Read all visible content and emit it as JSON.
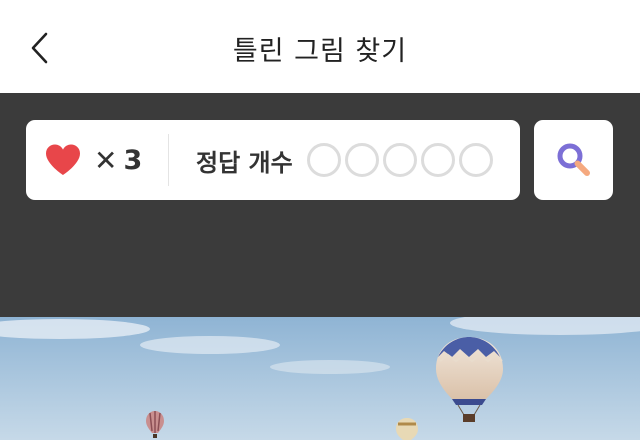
{
  "header": {
    "title": "틀린 그림 찾기",
    "back_icon": "chevron-left-icon"
  },
  "status": {
    "lives_icon": "heart-icon",
    "lives_multiplier": "✕",
    "lives_count": "3",
    "answers_label": "정답 개수",
    "answers_found": 0,
    "answers_total": 5
  },
  "hint_button": {
    "icon": "magnifier-icon"
  },
  "puzzle_image": {
    "subject": "hot-air-balloons"
  },
  "colors": {
    "panel_bg": "#3b3b3b",
    "heart": "#e8464a",
    "magnifier": "#7c6fd6",
    "empty_dot": "#dcdcdc"
  }
}
